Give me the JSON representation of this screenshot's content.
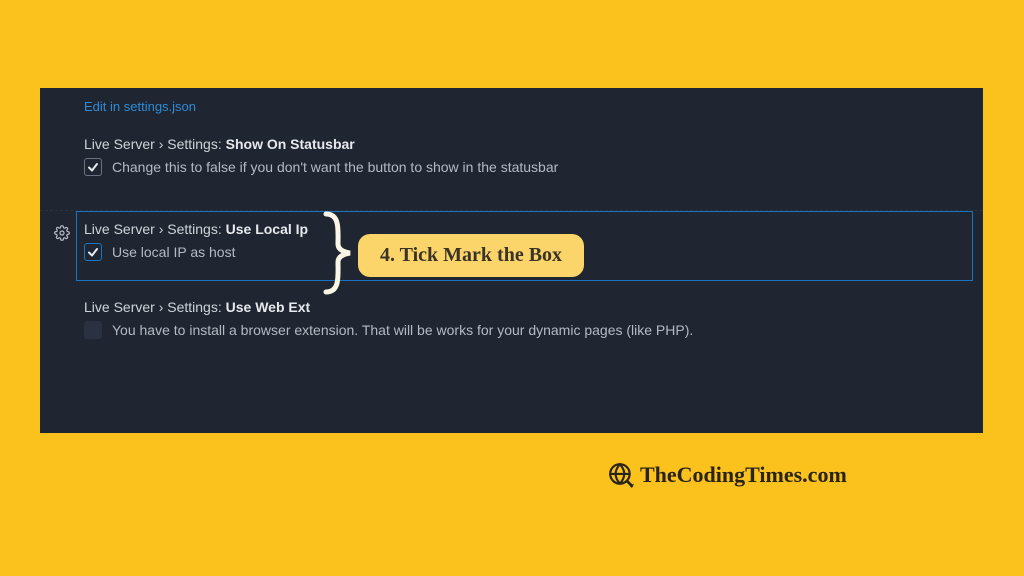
{
  "edit_link": "Edit in settings.json",
  "settings": {
    "statusbar": {
      "prefix": "Live Server › Settings: ",
      "name": "Show On Statusbar",
      "desc": "Change this to false if you don't want the button to show in the statusbar",
      "checked": true
    },
    "localip": {
      "prefix": "Live Server › Settings: ",
      "name": "Use Local Ip",
      "desc": "Use local IP as host",
      "checked": true
    },
    "webext": {
      "prefix": "Live Server › Settings: ",
      "name": "Use Web Ext",
      "desc": "You have to install a browser extension. That will be works for your dynamic pages (like PHP).",
      "checked": false
    }
  },
  "callout": "4. Tick Mark the Box",
  "watermark": "TheCodingTimes.com"
}
